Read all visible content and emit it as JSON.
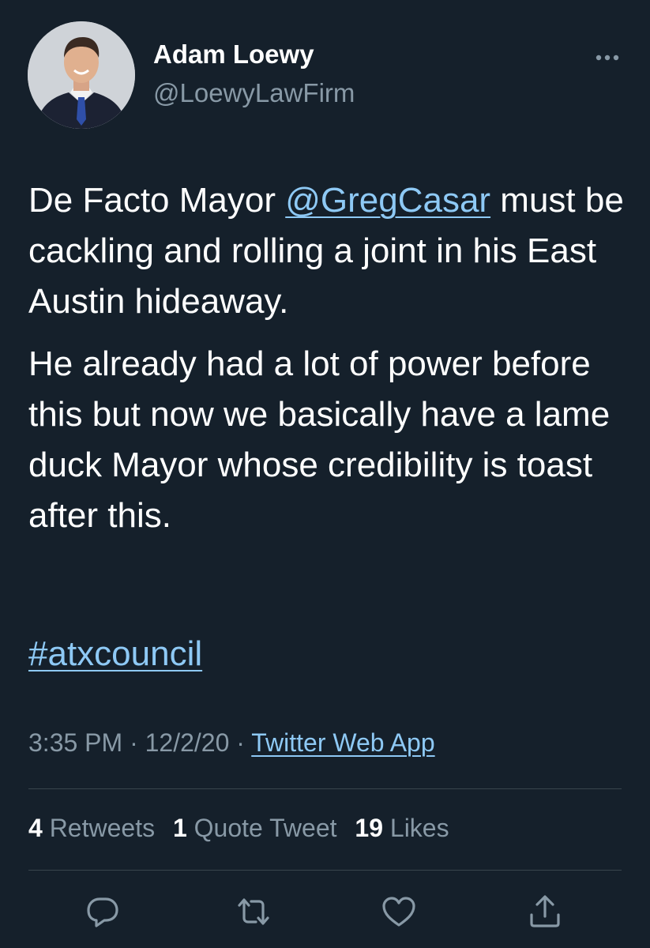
{
  "author": {
    "name": "Adam Loewy",
    "handle": "@LoewyLawFirm"
  },
  "tweet": {
    "para1_prefix": "De Facto Mayor ",
    "mention": "@GregCasar",
    "para1_suffix": " must be cackling and rolling a joint in his East Austin hideaway.",
    "para2": "He already had a lot of power before this but now we basically have a lame duck Mayor whose credibility is toast after this.",
    "hashtag": "#atxcouncil"
  },
  "meta": {
    "time": "3:35 PM",
    "separator": " · ",
    "date": "12/2/20",
    "source": "Twitter Web App"
  },
  "stats": {
    "retweets_count": "4",
    "retweets_label": "Retweets",
    "quotes_count": "1",
    "quotes_label": "Quote Tweet",
    "likes_count": "19",
    "likes_label": "Likes"
  },
  "actions": [
    "reply-icon",
    "retweet-icon",
    "like-icon",
    "share-icon"
  ],
  "colors": {
    "background": "#15202b",
    "secondary_text": "#8899a6",
    "link": "#8ec9f5",
    "divider": "#38444d"
  }
}
